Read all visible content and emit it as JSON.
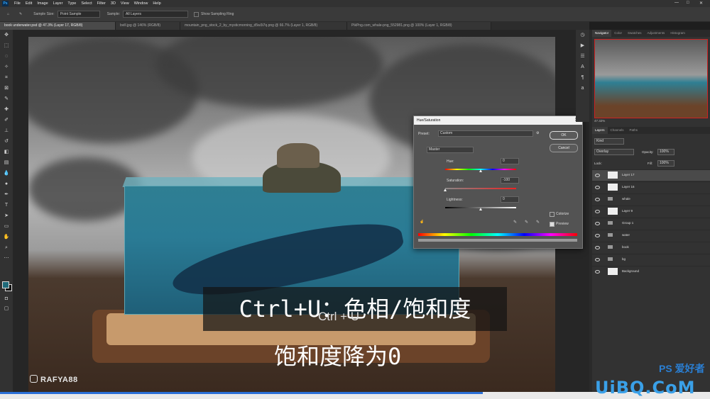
{
  "menubar": {
    "logo": "Ps",
    "items": [
      "File",
      "Edit",
      "Image",
      "Layer",
      "Type",
      "Select",
      "Filter",
      "3D",
      "View",
      "Window",
      "Help"
    ],
    "window_controls": {
      "minimize": "—",
      "maximize": "□",
      "close": "✕"
    }
  },
  "options": {
    "sample_size_label": "Sample Size:",
    "sample_size_value": "Point Sample",
    "sample_label": "Sample:",
    "sample_value": "All Layers",
    "show_ring_label": "Show Sampling Ring"
  },
  "tabs": [
    {
      "label": "book underwater.psd @ 47.3% (Layer 17, RGB/8)",
      "active": true
    },
    {
      "label": "bvill.jpg @ 146% (RGB/8)",
      "active": false
    },
    {
      "label": "mountain_png_stock_2_by_mysticmorning_d5w3i7q.png @ 66.7% (Layer 1, RGB/8)",
      "active": false
    },
    {
      "label": "PikPng.com_whale-png_552981.png @ 100% (Layer 1, RGB/8)",
      "active": false
    }
  ],
  "canvas": {
    "watermark": "RAFYA88"
  },
  "dialog": {
    "title": "Hue/Saturation",
    "preset_label": "Preset:",
    "preset_value": "Custom",
    "channel": "Master",
    "hue_label": "Hue:",
    "hue_value": "0",
    "saturation_label": "Saturation:",
    "saturation_value": "-100",
    "lightness_label": "Lightness:",
    "lightness_value": "0",
    "ok": "OK",
    "cancel": "Cancel",
    "colorize": "Colorize",
    "preview": "Preview",
    "hue_level": 0.5,
    "saturation_level": 0.0,
    "lightness_level": 0.5
  },
  "subtitles": {
    "line1": "Ctrl+U：色相/饱和度",
    "ghost_key": "Ctrl + U",
    "line2": "饱和度降为0"
  },
  "panels": {
    "top_tabs": [
      "Navigator",
      "Color",
      "Swatches",
      "Adjustments",
      "Histogram"
    ],
    "zoom": "47.32%",
    "layer_tabs": [
      "Layers",
      "Channels",
      "Paths"
    ],
    "kind_label": "Kind",
    "blend_mode": "Overlay",
    "opacity_label": "Opacity:",
    "opacity_value": "100%",
    "lock_label": "Lock:",
    "fill_label": "Fill:",
    "fill_value": "100%",
    "layers": [
      {
        "name": "Layer 17",
        "type": "layer",
        "selected": true
      },
      {
        "name": "Layer 16",
        "type": "layer",
        "selected": false
      },
      {
        "name": "whale",
        "type": "group",
        "selected": false
      },
      {
        "name": "Layer 9",
        "type": "mask",
        "selected": false
      },
      {
        "name": "Group 1",
        "type": "group",
        "selected": false
      },
      {
        "name": "water",
        "type": "group",
        "selected": false
      },
      {
        "name": "book",
        "type": "group",
        "selected": false
      },
      {
        "name": "bg",
        "type": "group",
        "selected": false
      },
      {
        "name": "Background",
        "type": "background",
        "selected": false
      }
    ]
  },
  "branding": {
    "uibq": "UiBQ.CoM",
    "ps_mark": "PS 爱好者"
  }
}
